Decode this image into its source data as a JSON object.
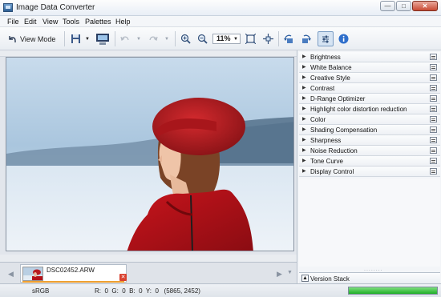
{
  "window": {
    "title": "Image Data Converter"
  },
  "menu": [
    "File",
    "Edit",
    "View",
    "Tools",
    "Palettes",
    "Help"
  ],
  "toolbar": {
    "view_mode_label": "View Mode",
    "zoom_value": "11%"
  },
  "palettes": [
    "Brightness",
    "White Balance",
    "Creative Style",
    "Contrast",
    "D-Range Optimizer",
    "Highlight color distortion reduction",
    "Color",
    "Shading Compensation",
    "Sharpness",
    "Noise Reduction",
    "Tone Curve",
    "Display Control"
  ],
  "version_stack": {
    "label": "Version Stack"
  },
  "filmstrip": {
    "file_name": "DSC02452.ARW"
  },
  "status": {
    "color_space": "sRGB",
    "pixel_values": "R:  0  G:  0  B:  0  Y:  0   (5865, 2452)",
    "progress": 1.0
  },
  "colors": {
    "progress": "#2bb52f",
    "accent": "#7b9dc4"
  }
}
